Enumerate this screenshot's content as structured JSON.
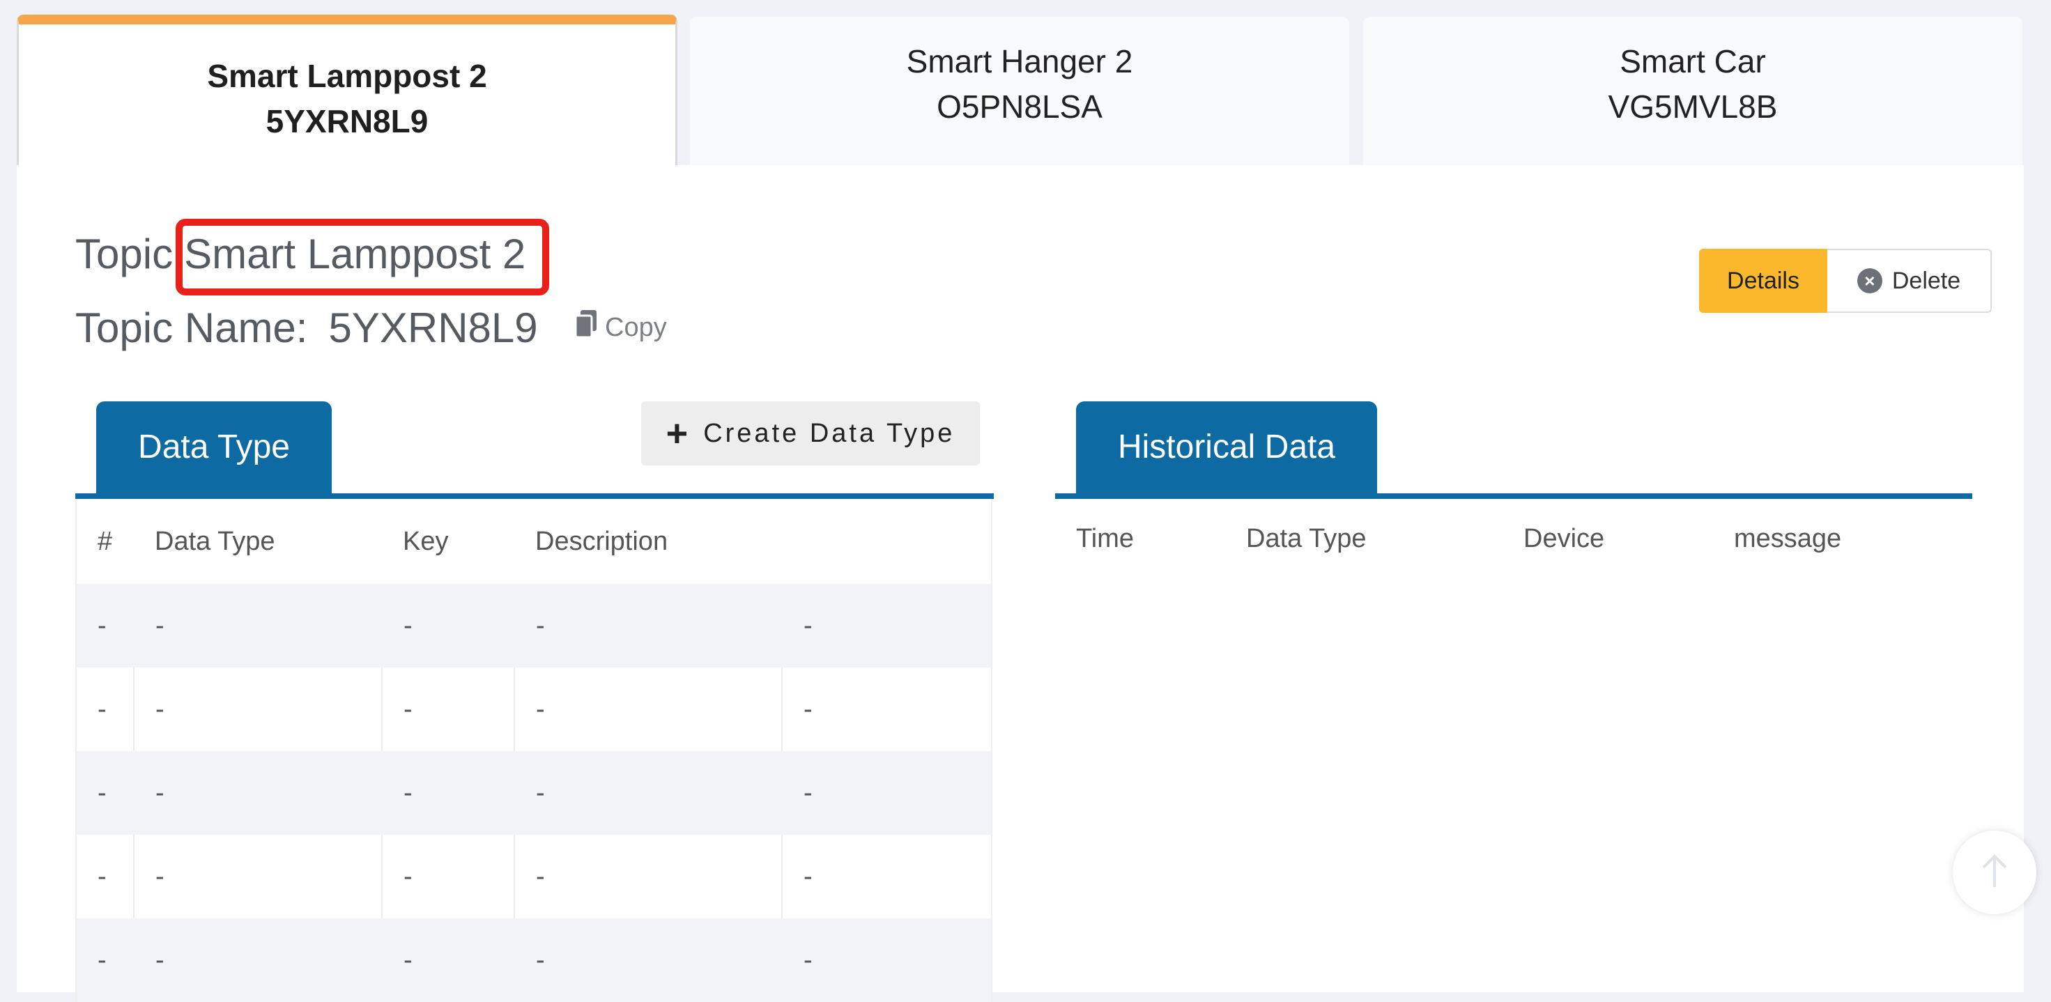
{
  "devices": [
    {
      "name": "Smart Lamppost 2",
      "code": "5YXRN8L9"
    },
    {
      "name": "Smart Hanger 2",
      "code": "O5PN8LSA"
    },
    {
      "name": "Smart Car",
      "code": "VG5MVL8B"
    }
  ],
  "topic": {
    "label": "Topic",
    "value": "Smart Lamppost 2",
    "name_label": "Topic Name:",
    "name_value": "5YXRN8L9",
    "copy_label": "Copy"
  },
  "actions": {
    "details_label": "Details",
    "delete_label": "Delete"
  },
  "data_type": {
    "tab_label": "Data Type",
    "create_label": "Create Data Type",
    "columns": [
      "#",
      "Data Type",
      "Key",
      "Description",
      ""
    ],
    "rows": [
      [
        "-",
        "-",
        "-",
        "-",
        "-"
      ],
      [
        "-",
        "-",
        "-",
        "-",
        "-"
      ],
      [
        "-",
        "-",
        "-",
        "-",
        "-"
      ],
      [
        "-",
        "-",
        "-",
        "-",
        "-"
      ],
      [
        "-",
        "-",
        "-",
        "-",
        "-"
      ]
    ]
  },
  "historical": {
    "tab_label": "Historical Data",
    "columns": [
      "Time",
      "Data Type",
      "Device",
      "message"
    ]
  },
  "colors": {
    "accent": "#0d6aa2",
    "active_tab_bar": "#f6a54b",
    "details_button": "#fbb82c",
    "highlight": "#e8221b"
  }
}
